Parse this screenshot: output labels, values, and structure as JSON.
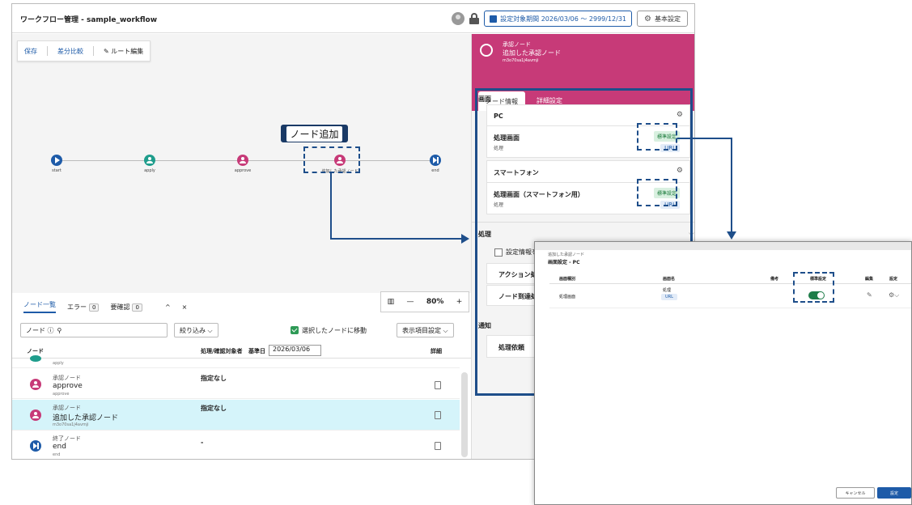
{
  "app": {
    "title": "ワークフロー管理 - sample_workflow",
    "period_label": "設定対象期間 2026/03/06 ～ 2999/12/31",
    "basic_settings": "基本設定"
  },
  "toolbar": {
    "save": "保存",
    "diff": "差分比較",
    "route_edit": "ルート編集"
  },
  "flow": {
    "nodes": [
      {
        "label": "start"
      },
      {
        "label": "apply"
      },
      {
        "label": "approve"
      },
      {
        "label": "追加した承認ノード"
      },
      {
        "label": "end"
      }
    ],
    "callout": "ノード追加"
  },
  "zoom": {
    "value": "80%",
    "minus": "—",
    "plus": "+"
  },
  "bottom_tabs": {
    "node_list": "ノード一覧",
    "error": "エラー",
    "error_count": "0",
    "review": "要確認",
    "review_count": "0",
    "collapse": "^",
    "close": "×"
  },
  "filters": {
    "search_prefix": "ノード ⓘ",
    "narrow": "絞り込み ⌵",
    "move_label": "選択したノードに移動",
    "display_settings": "表示項目設定 ⌵"
  },
  "table": {
    "col_node": "ノード",
    "col_target": "処理/確認対象者",
    "date_label": "基準日",
    "date_value": "2026/03/06",
    "col_detail": "詳細",
    "rows": [
      {
        "sub": "apply",
        "name": "",
        "code": "apply",
        "target": ""
      },
      {
        "sub": "承認ノード",
        "name": "approve",
        "code": "approve",
        "target": "指定なし"
      },
      {
        "sub": "承認ノード",
        "name": "追加した承認ノード",
        "code": "m3o70sa1j4avmji",
        "target": "指定なし"
      },
      {
        "sub": "終了ノード",
        "name": "end",
        "code": "end",
        "target": "-"
      }
    ]
  },
  "right_panel": {
    "type": "承認ノード",
    "name": "追加した承認ノード",
    "code": "m3o70sa1j4avmji",
    "tab_info": "ノード情報",
    "tab_detail": "詳細設定",
    "screen_section": "画面",
    "pc_title": "PC",
    "pc_screen_name": "処理画面",
    "pc_screen_sub": "処理",
    "std_badge": "標準設定",
    "url_badge": "URL",
    "sp_title": "スマートフォン",
    "sp_screen_name": "処理画面（スマートフォン用）",
    "sp_screen_sub": "処理",
    "process_section": "処理",
    "setting_info": "設定情報を表",
    "action_process": "アクション処理",
    "arrival_process": "ノード到達処理",
    "notify_section": "通知",
    "process_request": "処理依頼"
  },
  "dialog": {
    "node_name": "追加した承認ノード",
    "title": "画面設定 - PC",
    "col_type": "画面種別",
    "col_name": "画面名",
    "col_note": "備考",
    "col_std": "標準設定",
    "col_edit": "編集",
    "col_setting": "設定",
    "row_type": "処理画面",
    "row_name": "処理",
    "row_url": "URL",
    "cancel": "キャンセル",
    "ok": "設定"
  }
}
